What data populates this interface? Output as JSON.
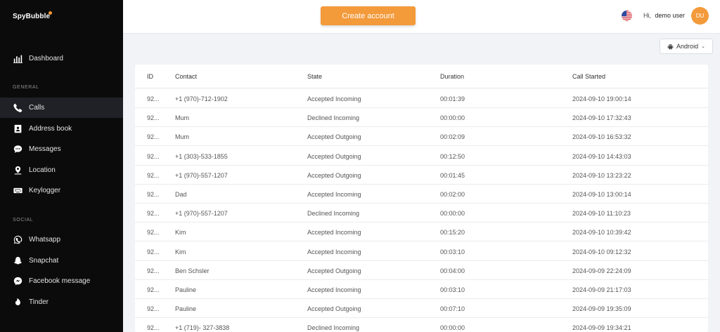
{
  "brand": {
    "name": "SpyBubble",
    "accent": "#f39a3b"
  },
  "sidebar": {
    "dashboard": {
      "label": "Dashboard",
      "icon": "chart-bars-icon"
    },
    "sections": [
      {
        "title": "GENERAL",
        "items": [
          {
            "label": "Calls",
            "icon": "phone-icon",
            "active": true
          },
          {
            "label": "Address book",
            "icon": "address-book-icon"
          },
          {
            "label": "Messages",
            "icon": "chat-bubble-icon"
          },
          {
            "label": "Location",
            "icon": "location-pin-icon"
          },
          {
            "label": "Keylogger",
            "icon": "keyboard-icon"
          }
        ]
      },
      {
        "title": "SOCIAL",
        "items": [
          {
            "label": "Whatsapp",
            "icon": "whatsapp-icon"
          },
          {
            "label": "Snapchat",
            "icon": "snapchat-ghost-icon"
          },
          {
            "label": "Facebook message",
            "icon": "messenger-icon"
          },
          {
            "label": "Tinder",
            "icon": "flame-icon"
          }
        ]
      }
    ]
  },
  "header": {
    "create_label": "Create account",
    "greeting": "Hi,",
    "user_name": "demo user",
    "avatar_initials": "DU"
  },
  "device": {
    "selected": "Android"
  },
  "table": {
    "headers": {
      "id": "ID",
      "contact": "Contact",
      "state": "State",
      "duration": "Duration",
      "started": "Call Started"
    },
    "rows": [
      {
        "id": "92...",
        "contact": "+1 (970)-712-1902",
        "state": "Accepted Incoming",
        "duration": "00:01:39",
        "started": "2024-09-10 19:00:14"
      },
      {
        "id": "92...",
        "contact": "Mum",
        "state": "Declined Incoming",
        "duration": "00:00:00",
        "started": "2024-09-10 17:32:43"
      },
      {
        "id": "92...",
        "contact": "Mum",
        "state": "Accepted Outgoing",
        "duration": "00:02:09",
        "started": "2024-09-10 16:53:32"
      },
      {
        "id": "92...",
        "contact": "+1 (303)-533-1855",
        "state": "Accepted Outgoing",
        "duration": "00:12:50",
        "started": "2024-09-10 14:43:03"
      },
      {
        "id": "92...",
        "contact": "+1 (970)-557-1207",
        "state": "Accepted Outgoing",
        "duration": "00:01:45",
        "started": "2024-09-10 13:23:22"
      },
      {
        "id": "92...",
        "contact": "Dad",
        "state": "Accepted Incoming",
        "duration": "00:02:00",
        "started": "2024-09-10 13:00:14"
      },
      {
        "id": "92...",
        "contact": "+1 (970)-557-1207",
        "state": "Declined Incoming",
        "duration": "00:00:00",
        "started": "2024-09-10 11:10:23"
      },
      {
        "id": "92...",
        "contact": "Kim",
        "state": "Accepted Incoming",
        "duration": "00:15:20",
        "started": "2024-09-10 10:39:42"
      },
      {
        "id": "92...",
        "contact": "Kim",
        "state": "Accepted Incoming",
        "duration": "00:03:10",
        "started": "2024-09-10 09:12:32"
      },
      {
        "id": "92...",
        "contact": "Ben Schsler",
        "state": "Accepted Outgoing",
        "duration": "00:04:00",
        "started": "2024-09-09 22:24:09"
      },
      {
        "id": "92...",
        "contact": "Pauline",
        "state": "Accepted Incoming",
        "duration": "00:03:10",
        "started": "2024-09-09 21:17:03"
      },
      {
        "id": "92...",
        "contact": "Pauline",
        "state": "Accepted Outgoing",
        "duration": "00:07:10",
        "started": "2024-09-09 19:35:09"
      },
      {
        "id": "92...",
        "contact": "+1 (719)- 327-3838",
        "state": "Declined Incoming",
        "duration": "00:00:00",
        "started": "2024-09-09 19:34:21"
      }
    ]
  }
}
